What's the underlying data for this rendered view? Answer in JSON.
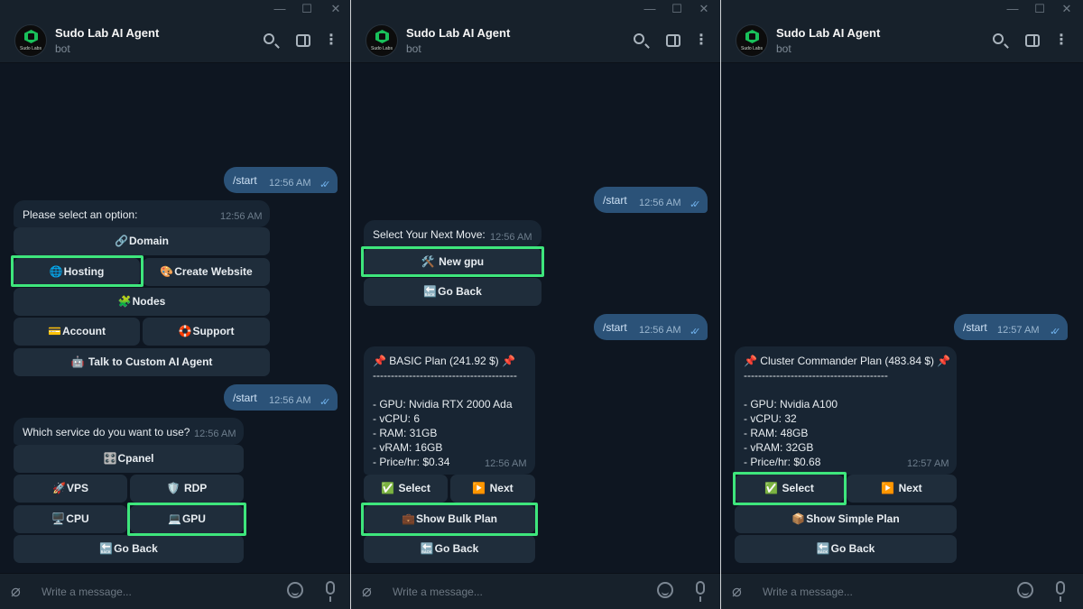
{
  "colors": {
    "accent": "#3ee67c",
    "bg": "#0e1621",
    "outgoing": "#2b5278",
    "incoming": "#182533",
    "button": "#1f2d3b"
  },
  "window_controls": {
    "minimize": "—",
    "maximize": "☐",
    "close": "✕"
  },
  "chat": {
    "title": "Sudo Lab AI Agent",
    "subtitle": "bot",
    "avatar_text": "Sudo Labs"
  },
  "composer": {
    "placeholder": "Write a message..."
  },
  "panel1": {
    "start1": {
      "text": "/start",
      "time": "12:56 AM"
    },
    "menu": {
      "text": "Please select an option:",
      "time": "12:56 AM"
    },
    "buttons": {
      "domain": "Domain",
      "hosting": "Hosting",
      "create_website": "Create Website",
      "nodes": "Nodes",
      "account": "Account",
      "support": "Support",
      "talk_ai": "Talk to Custom AI Agent"
    },
    "start2": {
      "text": "/start",
      "time": "12:56 AM"
    },
    "service": {
      "text": "Which service do you want to use?",
      "time": "12:56 AM"
    },
    "service_buttons": {
      "cpanel": "Cpanel",
      "vps": "VPS",
      "rdp": "RDP",
      "cpu": "CPU",
      "gpu": "GPU",
      "go_back": "Go Back"
    }
  },
  "panel2": {
    "start1": {
      "text": "/start",
      "time": "12:56 AM"
    },
    "next_move": {
      "text": "Select Your Next Move:",
      "time": "12:56 AM"
    },
    "buttons": {
      "new_gpu": "New gpu",
      "go_back": "Go Back"
    },
    "start2": {
      "text": "/start",
      "time": "12:56 AM"
    },
    "plan": {
      "text": "📌 BASIC Plan (241.92 $) 📌\n----------------------------------------\n\n- GPU: Nvidia RTX 2000 Ada\n- vCPU: 6\n- RAM: 31GB\n- vRAM: 16GB\n- Price/hr: $0.34",
      "time": "12:56 AM"
    },
    "plan_buttons": {
      "select": "Select",
      "next": "Next",
      "bulk": "Show Bulk Plan",
      "go_back": "Go Back"
    }
  },
  "panel3": {
    "start1": {
      "text": "/start",
      "time": "12:57 AM"
    },
    "plan": {
      "text": "📌 Cluster Commander Plan (483.84 $) 📌\n----------------------------------------\n\n- GPU: Nvidia A100\n- vCPU: 32\n- RAM: 48GB\n- vRAM: 32GB\n- Price/hr: $0.68",
      "time": "12:57 AM"
    },
    "plan_buttons": {
      "select": "Select",
      "next": "Next",
      "simple": "Show Simple Plan",
      "go_back": "Go Back"
    }
  }
}
